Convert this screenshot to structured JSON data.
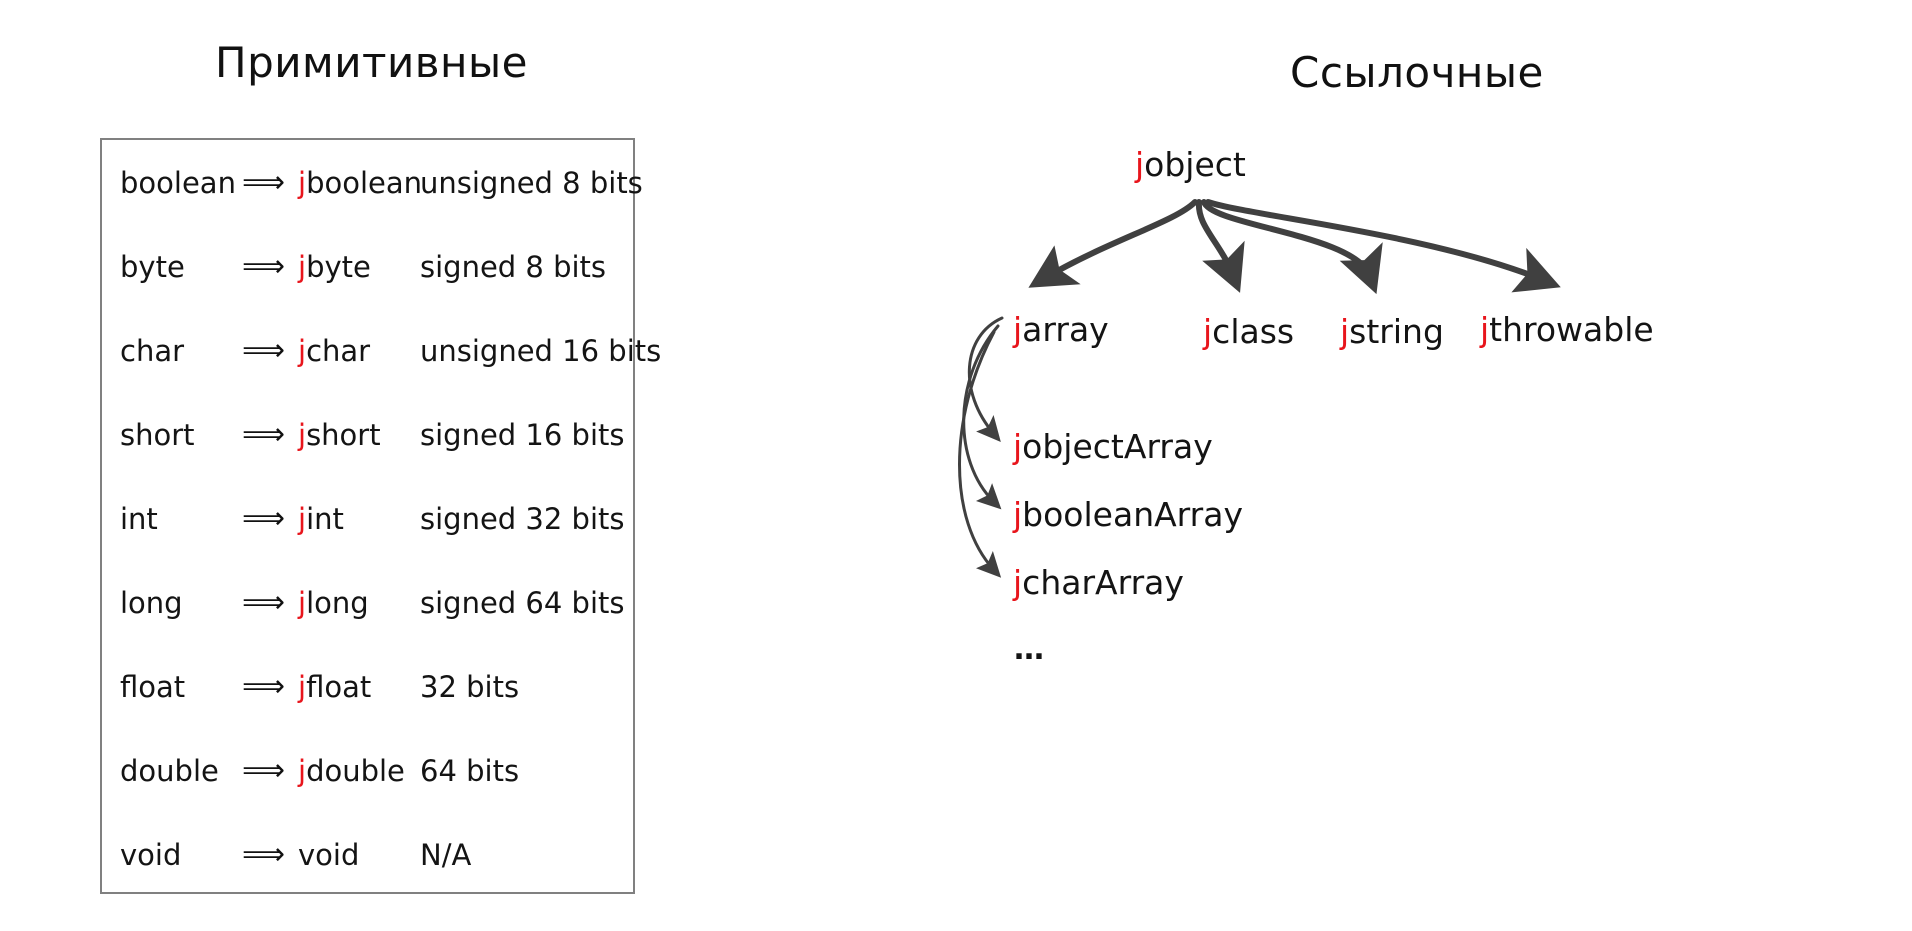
{
  "headings": {
    "primitives": "Примитивные",
    "reference": "Ссылочные"
  },
  "colors": {
    "j_prefix": "#e8151c",
    "text": "#141414",
    "table_border": "#808080",
    "arrow": "#404040",
    "background": "#ffffff"
  },
  "primitives_table": {
    "arrow_glyph": "⟹",
    "rows": [
      {
        "java_type": "boolean",
        "arrow": "⟹",
        "jni_prefix": "j",
        "jni_rest": "boolean",
        "bits": "unsigned 8 bits"
      },
      {
        "java_type": "byte",
        "arrow": "⟹",
        "jni_prefix": "j",
        "jni_rest": "byte",
        "bits": "signed 8 bits"
      },
      {
        "java_type": "char",
        "arrow": "⟹",
        "jni_prefix": "j",
        "jni_rest": "char",
        "bits": "unsigned 16 bits"
      },
      {
        "java_type": "short",
        "arrow": "⟹",
        "jni_prefix": "j",
        "jni_rest": "short",
        "bits": "signed 16 bits"
      },
      {
        "java_type": "int",
        "arrow": "⟹",
        "jni_prefix": "j",
        "jni_rest": "int",
        "bits": "signed 32 bits"
      },
      {
        "java_type": "long",
        "arrow": "⟹",
        "jni_prefix": "j",
        "jni_rest": "long",
        "bits": "signed 64 bits"
      },
      {
        "java_type": "float",
        "arrow": "⟹",
        "jni_prefix": "j",
        "jni_rest": "float",
        "bits": "32 bits"
      },
      {
        "java_type": "double",
        "arrow": "⟹",
        "jni_prefix": "j",
        "jni_rest": "double",
        "bits": "64 bits"
      },
      {
        "java_type": "void",
        "arrow": "⟹",
        "jni_prefix": "",
        "jni_rest": "void",
        "bits": "N/A"
      }
    ]
  },
  "reference_tree": {
    "root": {
      "prefix": "j",
      "rest": "object"
    },
    "children": [
      {
        "prefix": "j",
        "rest": "array"
      },
      {
        "prefix": "j",
        "rest": "class"
      },
      {
        "prefix": "j",
        "rest": "string"
      },
      {
        "prefix": "j",
        "rest": "throwable"
      }
    ],
    "array_children": [
      {
        "prefix": "j",
        "rest": "objectArray"
      },
      {
        "prefix": "j",
        "rest": "booleanArray"
      },
      {
        "prefix": "j",
        "rest": "charArray"
      }
    ],
    "ellipsis": "…"
  }
}
